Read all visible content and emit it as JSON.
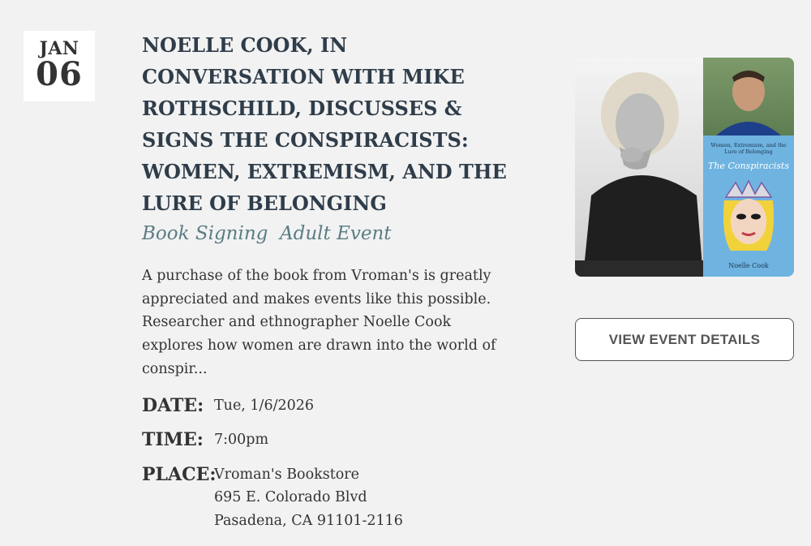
{
  "date": {
    "month": "JAN",
    "day": "06"
  },
  "event": {
    "title": "NOELLE COOK, IN CONVERSATION WITH MIKE ROTHSCHILD, DISCUSSES & SIGNS THE CONSPIRACISTS: WOMEN, EXTREMISM, AND THE LURE OF BELONGING",
    "tags": "Book Signing  Adult Event",
    "description": "A purchase of the book from Vroman's is greatly appreciated and makes events like this possible. Researcher and ethnographer Noelle Cook explores how women are drawn into the world of conspir...",
    "details": {
      "date_label": "DATE:",
      "date_value": "Tue, 1/6/2026",
      "time_label": "TIME:",
      "time_value": "7:00pm",
      "place_label": "PLACE:",
      "place_lines": [
        "Vroman's Bookstore",
        "695 E. Colorado Blvd",
        "Pasadena, CA 91101-2116"
      ]
    }
  },
  "book_cover": {
    "subtitle": "Women, Extremism, and the Lure of Belonging",
    "title": "The Conspiracists",
    "author": "Noelle Cook"
  },
  "button": {
    "label": "VIEW EVENT DETAILS"
  },
  "colors": {
    "background": "#f2f2f2",
    "title": "#2f3d4a",
    "tags": "#5a7d82",
    "cover_blue": "#6fb3e0"
  }
}
